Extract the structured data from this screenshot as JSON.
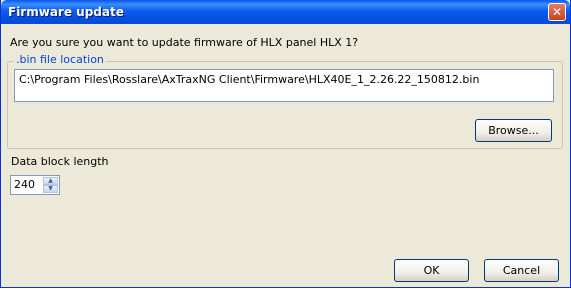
{
  "window": {
    "title": "Firmware update",
    "close_glyph": "✕"
  },
  "dialog": {
    "question": "Are you sure you want to update firmware of HLX panel HLX 1?",
    "bin_group_label": ".bin  file location",
    "bin_path": "C:\\Program Files\\Rosslare\\AxTraxNG Client\\Firmware\\HLX40E_1_2.26.22_150812.bin",
    "browse_label": "Browse...",
    "data_block_label": "Data block length",
    "data_block_value": "240",
    "ok_label": "OK",
    "cancel_label": "Cancel"
  },
  "colors": {
    "title_bar": "#0a58f0",
    "group_label": "#0046d5",
    "background": "#ece9d8"
  },
  "icons": {
    "close": "close-icon",
    "spin_up": "chevron-up-icon",
    "spin_down": "chevron-down-icon"
  }
}
